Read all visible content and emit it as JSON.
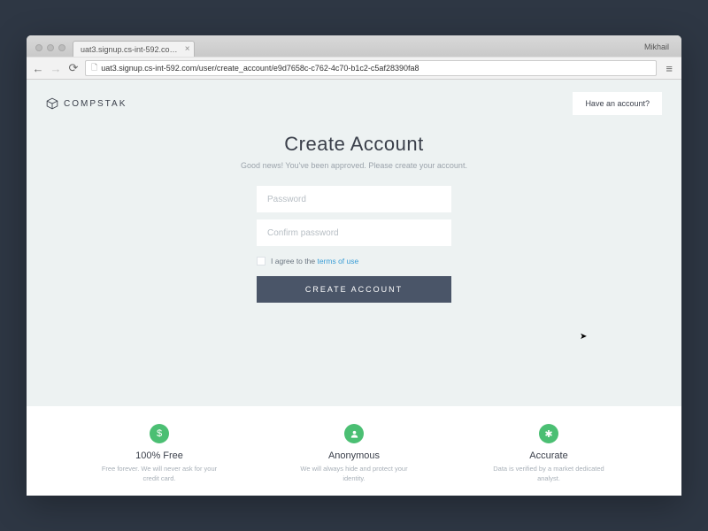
{
  "browser": {
    "tab_title": "uat3.signup.cs-int-592.co…",
    "user_label": "Mikhail",
    "url": "uat3.signup.cs-int-592.com/user/create_account/e9d7658c-c762-4c70-b1c2-c5af28390fa8"
  },
  "header": {
    "brand": "COMPSTAK",
    "have_account": "Have an account?"
  },
  "form": {
    "title": "Create Account",
    "subtitle": "Good news! You've been approved. Please create your account.",
    "password_placeholder": "Password",
    "confirm_placeholder": "Confirm password",
    "terms_prefix": "I agree to the ",
    "terms_link": "terms of use",
    "submit": "CREATE ACCOUNT"
  },
  "features": [
    {
      "icon": "$",
      "title": "100% Free",
      "desc": "Free forever. We will never ask for your credit card."
    },
    {
      "icon": "person",
      "title": "Anonymous",
      "desc": "We will always hide and protect your identity."
    },
    {
      "icon": "*",
      "title": "Accurate",
      "desc": "Data is verified by a market dedicated analyst."
    }
  ]
}
